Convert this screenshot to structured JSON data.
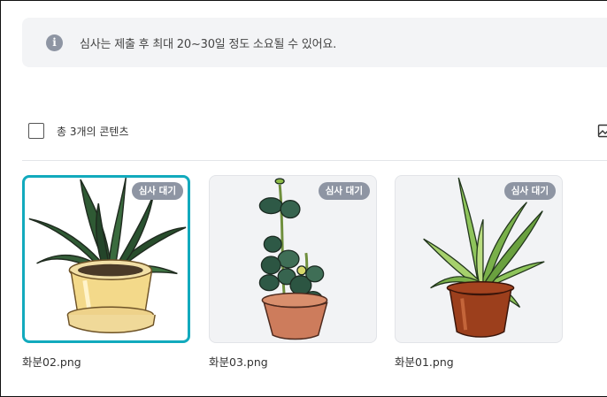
{
  "notice": {
    "icon": "info-icon",
    "text": "심사는 제출 후 최대 20~30일 정도 소요될 수 있어요."
  },
  "toolbar": {
    "count_label": "총 3개의 콘텐츠",
    "select_all_checked": false,
    "view_icon": "image-icon"
  },
  "items": [
    {
      "filename": "화분02.png",
      "badge": "심사 대기",
      "selected": true
    },
    {
      "filename": "화분03.png",
      "badge": "심사 대기",
      "selected": false
    },
    {
      "filename": "화분01.png",
      "badge": "심사 대기",
      "selected": false
    }
  ],
  "colors": {
    "accent": "#12aabd",
    "badge_bg": "#8e95a3",
    "notice_bg": "#f3f4f6"
  }
}
